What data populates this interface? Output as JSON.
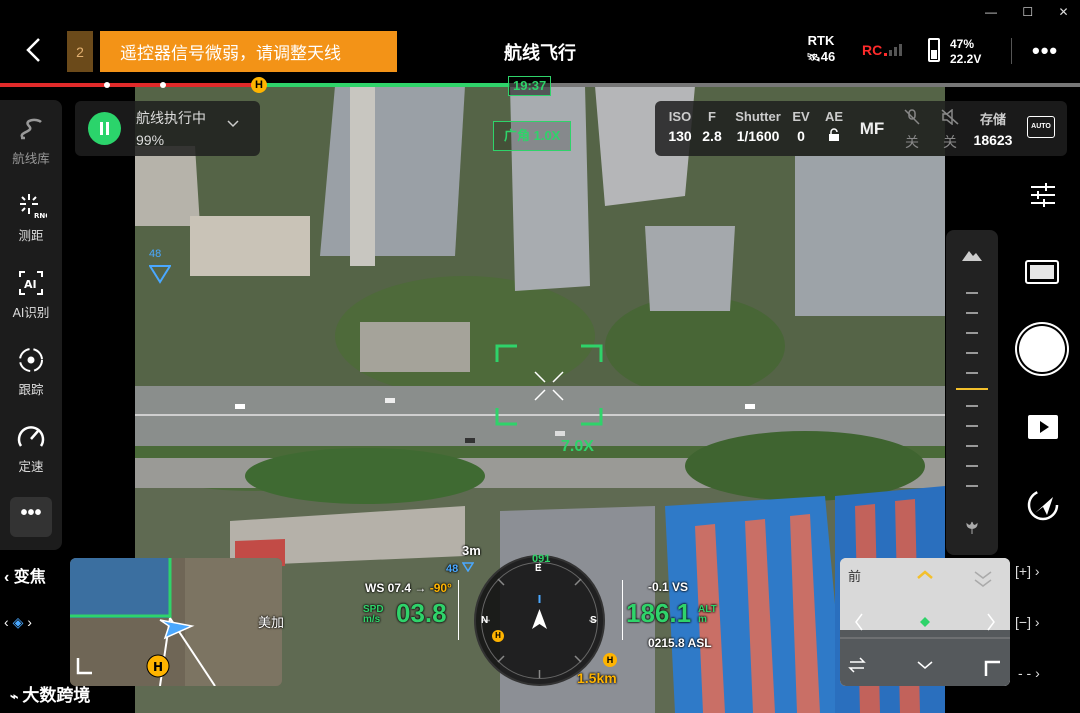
{
  "window": {
    "title": "航线飞行",
    "controls": [
      "—",
      "☐",
      "✕"
    ]
  },
  "warning": {
    "count": "2",
    "message": "遥控器信号微弱，请调整天线"
  },
  "status": {
    "rtk_label": "RTK",
    "rtk_sats": "46",
    "rc_label": "RC",
    "battery_percent": "47%",
    "battery_voltage": "22.2V"
  },
  "progress": {
    "elapsed_time": "19:37",
    "completed_fraction": 0.47,
    "home_marker": "H"
  },
  "left_sidebar": {
    "items": [
      {
        "label": "航线库",
        "icon": "route-library-icon"
      },
      {
        "label": "测距",
        "icon": "rng-laser-icon",
        "badge": "RNG"
      },
      {
        "label": "AI识别",
        "icon": "ai-recognition-icon",
        "badge": "AI"
      },
      {
        "label": "跟踪",
        "icon": "track-icon"
      },
      {
        "label": "定速",
        "icon": "speedometer-icon"
      }
    ],
    "more": "•••"
  },
  "mission": {
    "title": "航线执行中",
    "progress": "99%"
  },
  "camera": {
    "lens": "广角 1.0X",
    "iso_label": "ISO",
    "iso": "130",
    "f_label": "F",
    "f": "2.8",
    "shutter_label": "Shutter",
    "shutter": "1/1600",
    "ev_label": "EV",
    "ev": "0",
    "ae_label": "AE",
    "focus": "MF",
    "mic_off": "关",
    "sound_off": "关",
    "storage_label": "存储",
    "storage": "18623",
    "auto_label": "AUTO"
  },
  "hud": {
    "target_zoom": "7.0X",
    "altitude_marker": "48",
    "altitude_marker2": "48",
    "scale": "3m",
    "wind": "WS 07.4 →",
    "wind_dir": "-90°",
    "spd_label": "SPD\nm/s",
    "speed": "03.8",
    "heading": "091",
    "compass_e": "E",
    "compass_n": "N",
    "compass_s": "S",
    "vs": "-0.1 VS",
    "alt": "186.1",
    "alt_label": "ALT\nm",
    "asl": "0215.8 ASL",
    "home_distance": "1.5km",
    "map_label": "美加"
  },
  "left_bottom": {
    "zoom_label": "变焦"
  },
  "fpv": {
    "front_label": "前"
  },
  "right_bottom": {
    "plus": "[+]",
    "minus": "[−]",
    "dash": "- -"
  },
  "watermark": "大数跨境",
  "colors": {
    "accent_green": "#2fd36a",
    "warning_orange": "#f39317",
    "rc_red": "#ff2b2b"
  }
}
